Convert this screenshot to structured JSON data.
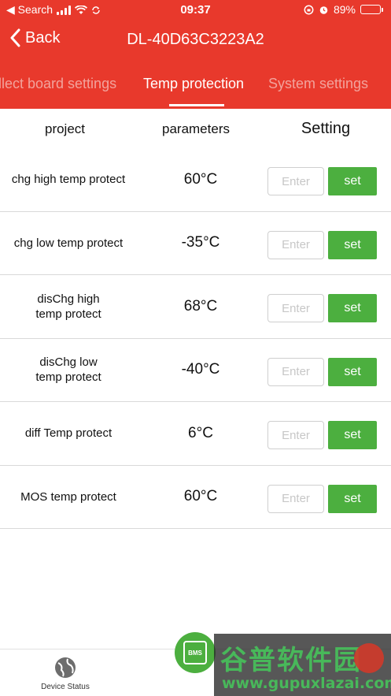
{
  "status_bar": {
    "back_app": "◀ Search",
    "time": "09:37",
    "battery_percent": "89%",
    "battery_level": 0.89
  },
  "nav": {
    "back_label": "Back",
    "title": "DL-40D63C3223A2"
  },
  "tabs": [
    {
      "label": "llect board settings",
      "active": false
    },
    {
      "label": "Temp protection",
      "active": true
    },
    {
      "label": "System settings",
      "active": false
    }
  ],
  "table": {
    "headers": [
      "project",
      "parameters",
      "Setting"
    ],
    "input_placeholder": "Enter",
    "set_label": "set",
    "rows": [
      {
        "project": "chg high temp protect",
        "value": "60°C"
      },
      {
        "project": "chg low temp protect",
        "value": "-35°C"
      },
      {
        "project": "disChg high\ntemp protect",
        "value": "68°C"
      },
      {
        "project": "disChg low\ntemp protect",
        "value": "-40°C"
      },
      {
        "project": "diff Temp protect",
        "value": "6°C"
      },
      {
        "project": "MOS temp protect",
        "value": "60°C"
      }
    ]
  },
  "bottom_bar": {
    "items": [
      {
        "label": "Device Status",
        "icon": "globe-icon"
      }
    ],
    "center_icon": "bms-chip-icon",
    "center_text": "BMS"
  },
  "watermark": {
    "main": "谷普软件园",
    "url": "www.gupuxlazai.com"
  },
  "colors": {
    "header_red": "#e8392c",
    "set_green": "#4caf3f",
    "divider": "#d9d9d9"
  }
}
